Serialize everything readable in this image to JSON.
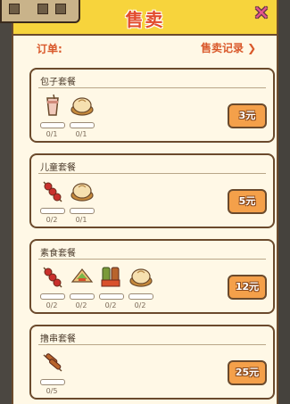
{
  "header": {
    "title": "售卖"
  },
  "orders": {
    "label": "订单:",
    "history_link": "售卖记录 ❯"
  },
  "sets": [
    {
      "name": "包子套餐",
      "price": "3元",
      "items": [
        {
          "icon": "milk-tea-icon",
          "count": "0/1"
        },
        {
          "icon": "steamed-bun-icon",
          "count": "0/1"
        }
      ]
    },
    {
      "name": "儿童套餐",
      "price": "5元",
      "items": [
        {
          "icon": "meat-skewer-icon",
          "count": "0/2"
        },
        {
          "icon": "steamed-bun-icon",
          "count": "0/1"
        }
      ]
    },
    {
      "name": "素食套餐",
      "price": "12元",
      "items": [
        {
          "icon": "meat-skewer-icon",
          "count": "0/2"
        },
        {
          "icon": "flatbread-wrap-icon",
          "count": "0/2"
        },
        {
          "icon": "vegetable-skewer-icon",
          "count": "0/2"
        },
        {
          "icon": "steamed-bun-icon",
          "count": "0/2"
        }
      ]
    },
    {
      "name": "撸串套餐",
      "price": "25元",
      "items": [
        {
          "icon": "sausage-skewer-icon",
          "count": "0/5"
        }
      ]
    }
  ],
  "colors": {
    "accent": "#f7d43c",
    "price_button": "#f4a04a",
    "title": "#e24b2c",
    "close": "#e8558f"
  }
}
